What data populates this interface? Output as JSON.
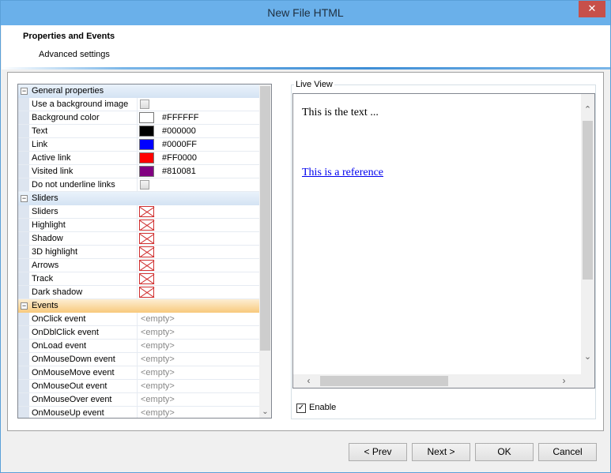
{
  "window": {
    "title": "New File HTML",
    "close_glyph": "✕"
  },
  "header": {
    "title": "Properties and Events",
    "subtitle": "Advanced settings"
  },
  "property_grid": {
    "categories": [
      {
        "label": "General properties",
        "expander": "−",
        "rows": [
          {
            "name": "Use a background image",
            "type": "checkbox",
            "checked": false
          },
          {
            "name": "Background color",
            "type": "color",
            "color": "#FFFFFF",
            "value": "#FFFFFF"
          },
          {
            "name": "Text",
            "type": "color",
            "color": "#000000",
            "value": "#000000"
          },
          {
            "name": "Link",
            "type": "color",
            "color": "#0000FF",
            "value": "#0000FF"
          },
          {
            "name": "Active link",
            "type": "color",
            "color": "#FF0000",
            "value": "#FF0000"
          },
          {
            "name": "Visited link",
            "type": "color",
            "color": "#810081",
            "value": "#810081"
          },
          {
            "name": "Do not underline links",
            "type": "checkbox",
            "checked": false
          }
        ]
      },
      {
        "label": "Sliders",
        "expander": "−",
        "rows": [
          {
            "name": "Sliders",
            "type": "nocolor"
          },
          {
            "name": "Highlight",
            "type": "nocolor"
          },
          {
            "name": "Shadow",
            "type": "nocolor"
          },
          {
            "name": "3D highlight",
            "type": "nocolor"
          },
          {
            "name": "Arrows",
            "type": "nocolor"
          },
          {
            "name": "Track",
            "type": "nocolor"
          },
          {
            "name": "Dark shadow",
            "type": "nocolor"
          }
        ]
      },
      {
        "label": "Events",
        "expander": "−",
        "highlight": true,
        "rows": [
          {
            "name": "OnClick event",
            "type": "event",
            "value": "<empty>"
          },
          {
            "name": "OnDblClick event",
            "type": "event",
            "value": "<empty>"
          },
          {
            "name": "OnLoad event",
            "type": "event",
            "value": "<empty>"
          },
          {
            "name": "OnMouseDown event",
            "type": "event",
            "value": "<empty>"
          },
          {
            "name": "OnMouseMove event",
            "type": "event",
            "value": "<empty>"
          },
          {
            "name": "OnMouseOut event",
            "type": "event",
            "value": "<empty>"
          },
          {
            "name": "OnMouseOver event",
            "type": "event",
            "value": "<empty>"
          },
          {
            "name": "OnMouseUp event",
            "type": "event",
            "value": "<empty>"
          }
        ]
      }
    ]
  },
  "live_view": {
    "caption": "Live View",
    "text": "This is the text ...",
    "link": "This is a reference",
    "enable_label": "Enable",
    "enable_checked": true
  },
  "buttons": {
    "prev": "< Prev",
    "next": "Next >",
    "ok": "OK",
    "cancel": "Cancel"
  },
  "icons": {
    "checkmark": "✓",
    "scroll_up": "⌃",
    "scroll_down": "⌄",
    "scroll_left": "‹",
    "scroll_right": "›"
  }
}
